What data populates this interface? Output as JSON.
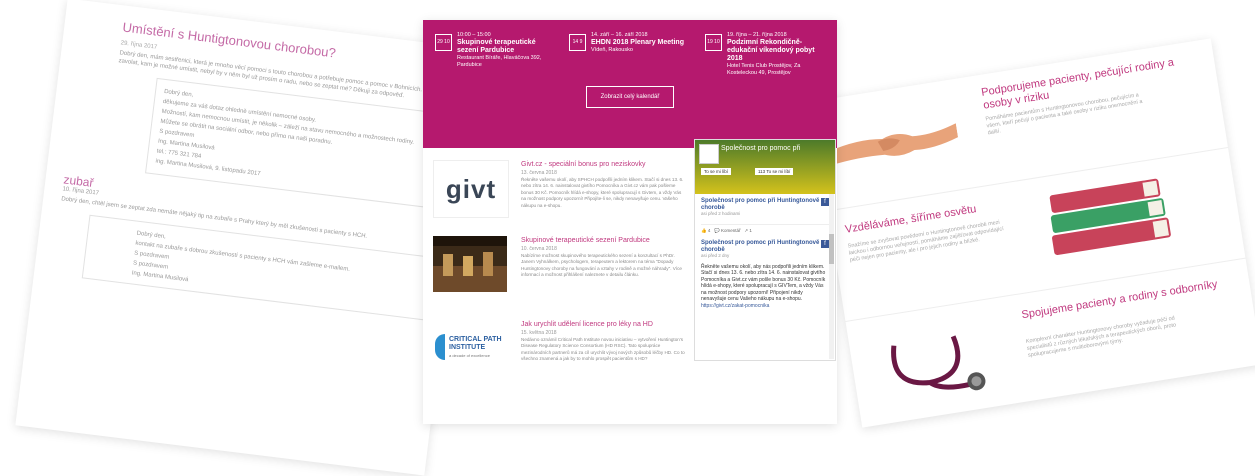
{
  "left_page": {
    "article1": {
      "title": "Umístění s Huntigtonovou chorobou?",
      "date": "29. října 2017",
      "lead": "Dobrý den, mám sestřenici, která je mnoho věcí pomoci s touto chorobou a potřebuje pomoc a pomoc v Bohnicích. Kam zavolat, kam je možné umístit, nebyl by v něm byl už prosím o radu, nebo se zeptat mé? Děkuji za odpověď.",
      "reply_lines": [
        "Dobrý den,",
        "děkujeme za váš dotaz ohledně umístění nemocné osoby.",
        "Možností, kam nemocnou umístit, je několik – záleží na stavu nemocného a možnostech rodiny.",
        "Můžete se obrátit na sociální odbor, nebo přímo na naši poradnu.",
        "S pozdravem",
        "Ing. Martina Musilová",
        "tel.: 775 321 784",
        "ing. Martina Musilová, 9. listopadu 2017"
      ]
    },
    "article2": {
      "title": "zubař",
      "date": "10. října 2017",
      "lead": "Dobrý den, chtěl jsem se zeptat zda nemáte nějaký tip na zubaře s Prahy který by měl zkušenosti s pacienty s HCH.",
      "reply_lines": [
        "Dobrý den,",
        "kontakt na zubaře s dobrou zkušeností s pacienty s HCH vám zašleme e-mailem.",
        "S pozdravem",
        "S pozdravem",
        "Ing. Martina Musilová"
      ]
    }
  },
  "hero": {
    "events": [
      {
        "cal": "29 10",
        "time": "10:00 – 15:00",
        "title": "Skupinové terapeutické sezení Pardubice",
        "place": "Restaurant Bíráře, Hlaváčova 392, Pardubice"
      },
      {
        "cal": "14 9",
        "time": "14. září – 16. září 2018",
        "title": "EHDN 2018 Plenary Meeting",
        "place": "Vídeň, Rakousko"
      },
      {
        "cal": "19 10",
        "time": "19. října – 21. října 2018",
        "title": "Podzimní Rekondičně-edukační víkendový pobyt 2018",
        "place": "Hotel Tenis Club Prostějov, Za Kosteleckou 49, Prostějov"
      }
    ],
    "calendar_button": "Zobrazit celý kalendář"
  },
  "posts": [
    {
      "title": "Givt.cz - speciální bonus pro neziskovky",
      "date": "13. června 2018",
      "text": "Řekněte vašemu okolí, aby SPHCH podpořili jedním klikem. Stačí si dnes 13. 6. nebo zítra 14. 6. nainstalovat givtího Pomocníka a Givt.cz vám pak pošleme bonus 30 Kč. Pomocník hlídá e-shopy, které spolupracují s Givtem, a vždy Vás na možnost podpory upozorní! Připojíte-li se, nikdy nenavyšuje cenu. Vašeho nákupu na e-shopu.",
      "logo": "givt"
    },
    {
      "title": "Skupinové terapeutické sezení Pardubice",
      "date": "10. června 2018",
      "text": "Nabízíme možnost skupinového terapeutického sezení a konzultací s PhDr. Janem Vyhnálkem, psychologem, terapeutem a lektorem na téma \"Dopady Huntingtonovy choroby na fungování a vztahy v rodině a možné náhrady\". Více informací a možnost přihlášení naleznete v detailu článku."
    },
    {
      "title": "Jak urychlit udělení licence pro léky na HD",
      "date": "15. května 2018",
      "text": "Nedávno oznámil Critical Path Institute novou iniciativu – vytvoření Huntington's Disease Regulatory Science Consortium (HD RSC). Tato spolupráce mezinárodních partnerů má za cíl urychlit vývoj nových způsobů léčby HD. Co to všechno znamená a jak by to mohlo prospět pacientům s HD?",
      "logo_lines": [
        "CRITICAL PATH",
        "INSTITUTE",
        "a decade of excellence"
      ]
    }
  ],
  "facebook": {
    "page_name": "Společnost pro pomoc při",
    "like_label": "To se mi líbí",
    "share_label": "Sdílet",
    "likes_count": "113 To se mi líbí",
    "post1": {
      "name": "Společnost pro pomoc při Huntingtonově chorobě",
      "time": "asi před 2 hodinami"
    },
    "actions": {
      "like": "4",
      "comment": "Komentář",
      "share": "1"
    },
    "post2": {
      "name": "Společnost pro pomoc při Huntingtonově chorobě",
      "time": "asi před 2 dny",
      "text": "Řekněte vašemu okolí, aby nás podpořili jedním klikem. Stačí si dnes 13. 6. nebo zítra 14. 6. nainstalovat givtího Pomocníka a Givt.cz vám pošle bonus 30 Kč. Pomocník hlídá e-shopy, které spolupracují s GIVTem, a vždy Vás na možnost podpory upozorní! Připojení nikdy nenavyšuje cenu Vašeho nákupu na e-shopu.",
      "link": "https://givt.cz/zakat-pomocnika"
    }
  },
  "right_page": {
    "sections": [
      {
        "title": "Podporujeme pacienty, pečující rodiny a osoby v riziku",
        "text": "Pomáháme pacientům s Huntingtonovou chorobou, pečujícím a všem, kteří pečují o pacienta a také osoby v riziku onemocnění a další.",
        "image": "handshake"
      },
      {
        "title": "Vzděláváme, šíříme osvětu",
        "text": "Snažíme se zvyšovat povědomí o Huntingtonově chorobě mezi laickou i odbornou veřejností, pomáháme zajišťovat odpovídající péči nejen pro pacienty, ale i pro jejich rodiny a blízké.",
        "image": "books"
      },
      {
        "title": "Spojujeme pacienty a rodiny s odborníky",
        "text": "Komplexní charakter Huntingtonovy choroby vyžaduje péči od specialistů z různých lékařských a terapeutických oborů, proto spolupracujeme s multioborovými týmy.",
        "image": "stethoscope"
      }
    ]
  },
  "colors": {
    "accent": "#b5196e",
    "link": "#c0397f"
  }
}
